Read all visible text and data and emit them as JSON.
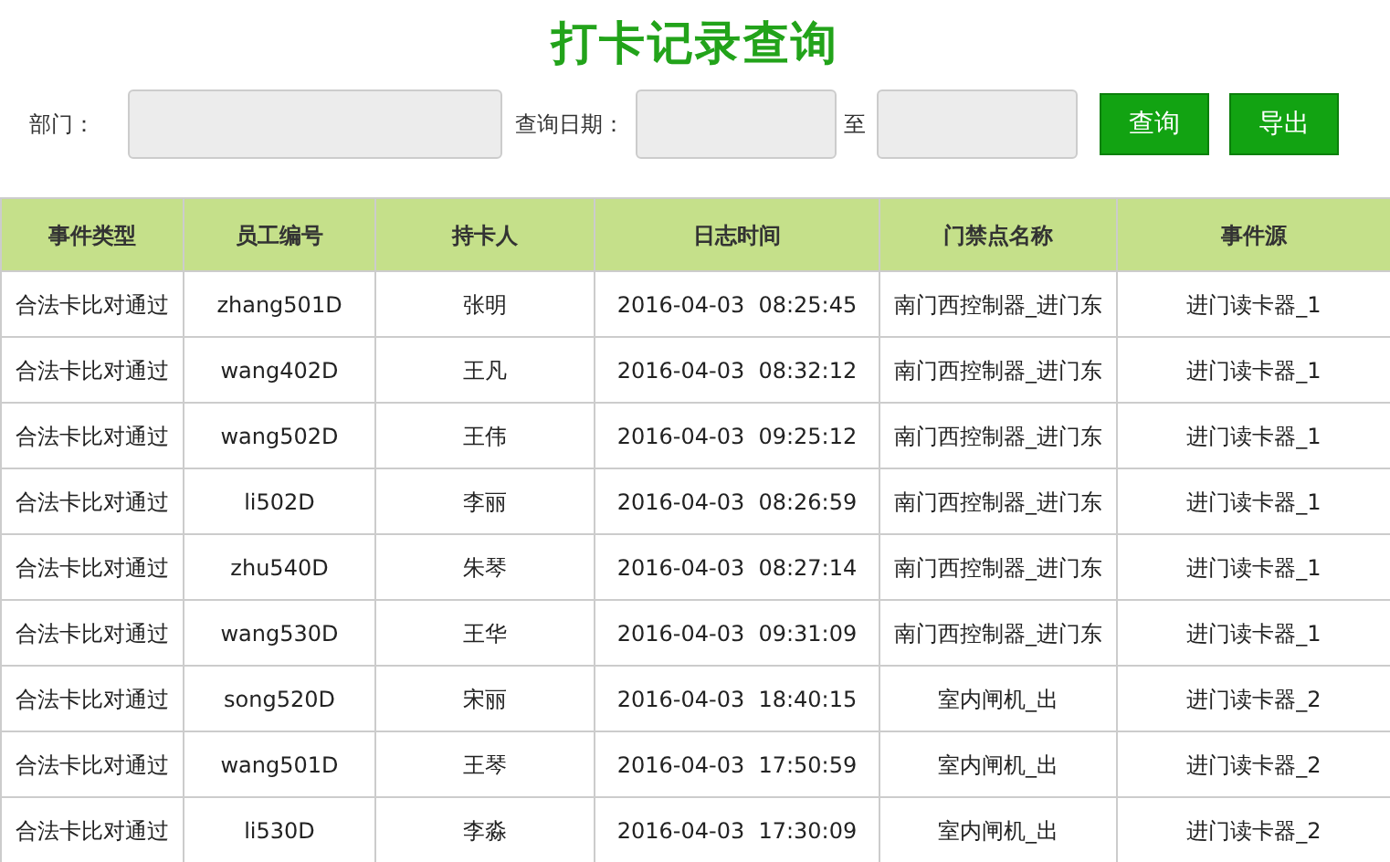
{
  "title": "打卡记录查询",
  "form": {
    "dept_label": "部门：",
    "date_label": "查询日期：",
    "to_label": "至",
    "buttons": [
      "查询",
      "导出"
    ]
  },
  "table": {
    "columns": [
      "事件类型",
      "员工编号",
      "持卡人",
      "日志时间",
      "门禁点名称",
      "事件源"
    ],
    "rows": [
      [
        "合法卡比对通过",
        "zhang501D",
        "张明",
        "2016-04-03  08:25:45",
        "南门西控制器_进门东",
        "进门读卡器_1"
      ],
      [
        "合法卡比对通过",
        "wang402D",
        "王凡",
        "2016-04-03  08:32:12",
        "南门西控制器_进门东",
        "进门读卡器_1"
      ],
      [
        "合法卡比对通过",
        "wang502D",
        "王伟",
        "2016-04-03  09:25:12",
        "南门西控制器_进门东",
        "进门读卡器_1"
      ],
      [
        "合法卡比对通过",
        "li502D",
        "李丽",
        "2016-04-03  08:26:59",
        "南门西控制器_进门东",
        "进门读卡器_1"
      ],
      [
        "合法卡比对通过",
        "zhu540D",
        "朱琴",
        "2016-04-03  08:27:14",
        "南门西控制器_进门东",
        "进门读卡器_1"
      ],
      [
        "合法卡比对通过",
        "wang530D",
        "王华",
        "2016-04-03  09:31:09",
        "南门西控制器_进门东",
        "进门读卡器_1"
      ],
      [
        "合法卡比对通过",
        "song520D",
        "宋丽",
        "2016-04-03  18:40:15",
        "室内闸机_出",
        "进门读卡器_2"
      ],
      [
        "合法卡比对通过",
        "wang501D",
        "王琴",
        "2016-04-03  17:50:59",
        "室内闸机_出",
        "进门读卡器_2"
      ],
      [
        "合法卡比对通过",
        "li530D",
        "李淼",
        "2016-04-03  17:30:09",
        "室内闸机_出",
        "进门读卡器_2"
      ]
    ]
  }
}
